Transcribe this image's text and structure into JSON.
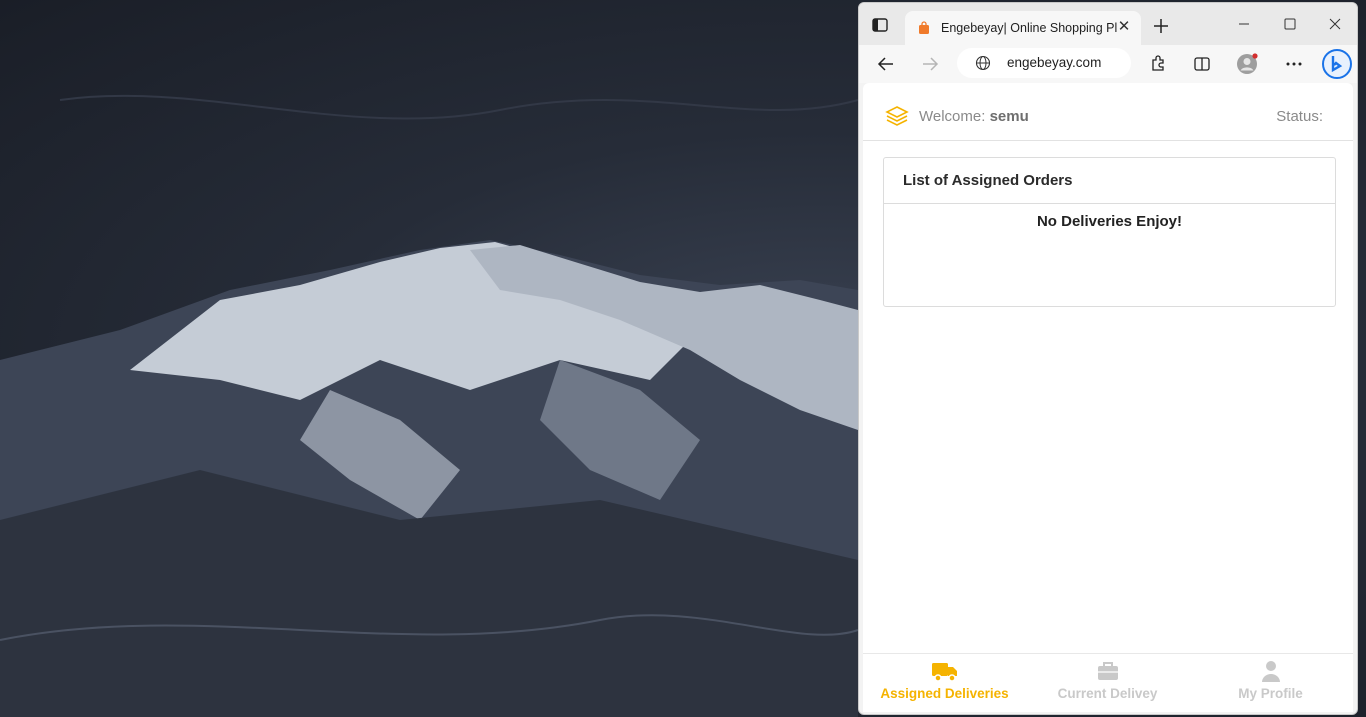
{
  "browser": {
    "tab_title": "Engebeyay| Online Shopping Platform",
    "tab_close": "✕",
    "url": "engebeyay.com"
  },
  "page": {
    "welcome_label": "Welcome:",
    "welcome_name": "semu",
    "status_label": "Status:",
    "card_title": "List of Assigned Orders",
    "empty_message": "No Deliveries Enjoy!"
  },
  "bottom_nav": {
    "items": [
      {
        "label": "Assigned Deliveries",
        "icon": "truck-icon",
        "active": true
      },
      {
        "label": "Current Delivey",
        "icon": "briefcase-icon",
        "active": false
      },
      {
        "label": "My Profile",
        "icon": "user-icon",
        "active": false
      }
    ]
  },
  "colors": {
    "accent": "#f5b301",
    "inactive": "#c9c9c9",
    "bing_blue": "#1a73e8"
  }
}
